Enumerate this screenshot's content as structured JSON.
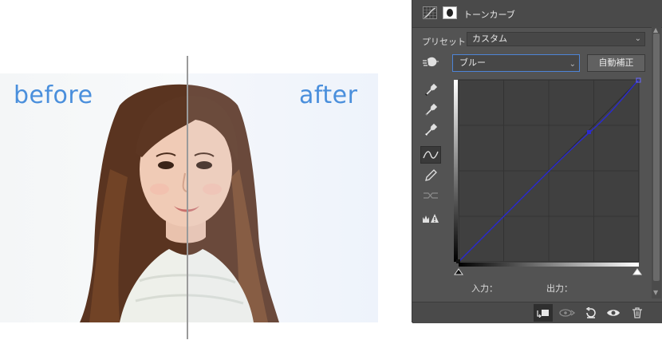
{
  "comparison": {
    "before_label": "before",
    "after_label": "after"
  },
  "panel": {
    "title": "トーンカーブ",
    "preset_label": "プリセット：",
    "preset_value": "カスタム",
    "channel_value": "ブルー",
    "auto_button": "自動補正",
    "input_label": "入力：",
    "output_label": "出力：",
    "tools": [
      "point-eyedropper-black-icon",
      "point-eyedropper-gray-icon",
      "point-eyedropper-white-icon",
      "curve-edit-icon",
      "pencil-icon",
      "smooth-icon",
      "clipping-warning-icon"
    ],
    "footer_icons": [
      "clip-to-layer-icon",
      "view-previous-state-icon",
      "reset-icon",
      "visibility-eye-icon",
      "trash-icon"
    ]
  },
  "colors": {
    "label_blue": "#4a8fdc",
    "panel_bg": "#535353",
    "graph_bg": "#404040",
    "curve_blue": "#2a2ad0",
    "select_focus": "#4d84d6"
  }
}
